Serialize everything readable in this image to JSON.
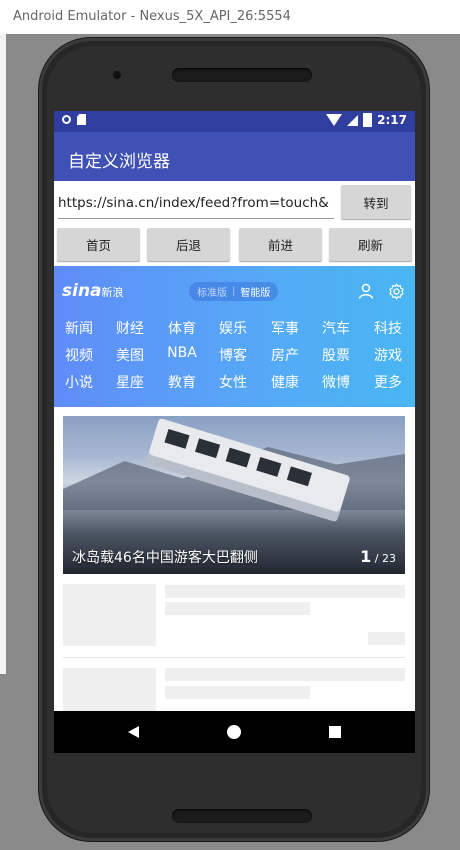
{
  "window": {
    "title": "Android Emulator - Nexus_5X_API_26:5554"
  },
  "status_bar": {
    "time": "2:17"
  },
  "app": {
    "title": "自定义浏览器"
  },
  "url_bar": {
    "value": "https://sina.cn/index/feed?from=touch&",
    "go_label": "转到"
  },
  "nav_buttons": [
    {
      "label": "首页"
    },
    {
      "label": "后退"
    },
    {
      "label": "前进"
    },
    {
      "label": "刷新"
    }
  ],
  "sina": {
    "logo": "sina",
    "logo_sub": "新浪",
    "mode_standard": "标准版",
    "mode_smart": "智能版",
    "channels": [
      [
        "新闻",
        "财经",
        "体育",
        "娱乐",
        "军事",
        "汽车",
        "科技"
      ],
      [
        "视频",
        "美图",
        "NBA",
        "博客",
        "房产",
        "股票",
        "游戏"
      ],
      [
        "小说",
        "星座",
        "教育",
        "女性",
        "健康",
        "微博",
        "更多"
      ]
    ]
  },
  "news": {
    "caption": "冰岛载46名中国游客大巴翻侧",
    "page_current": "1",
    "page_total": "/ 23"
  }
}
